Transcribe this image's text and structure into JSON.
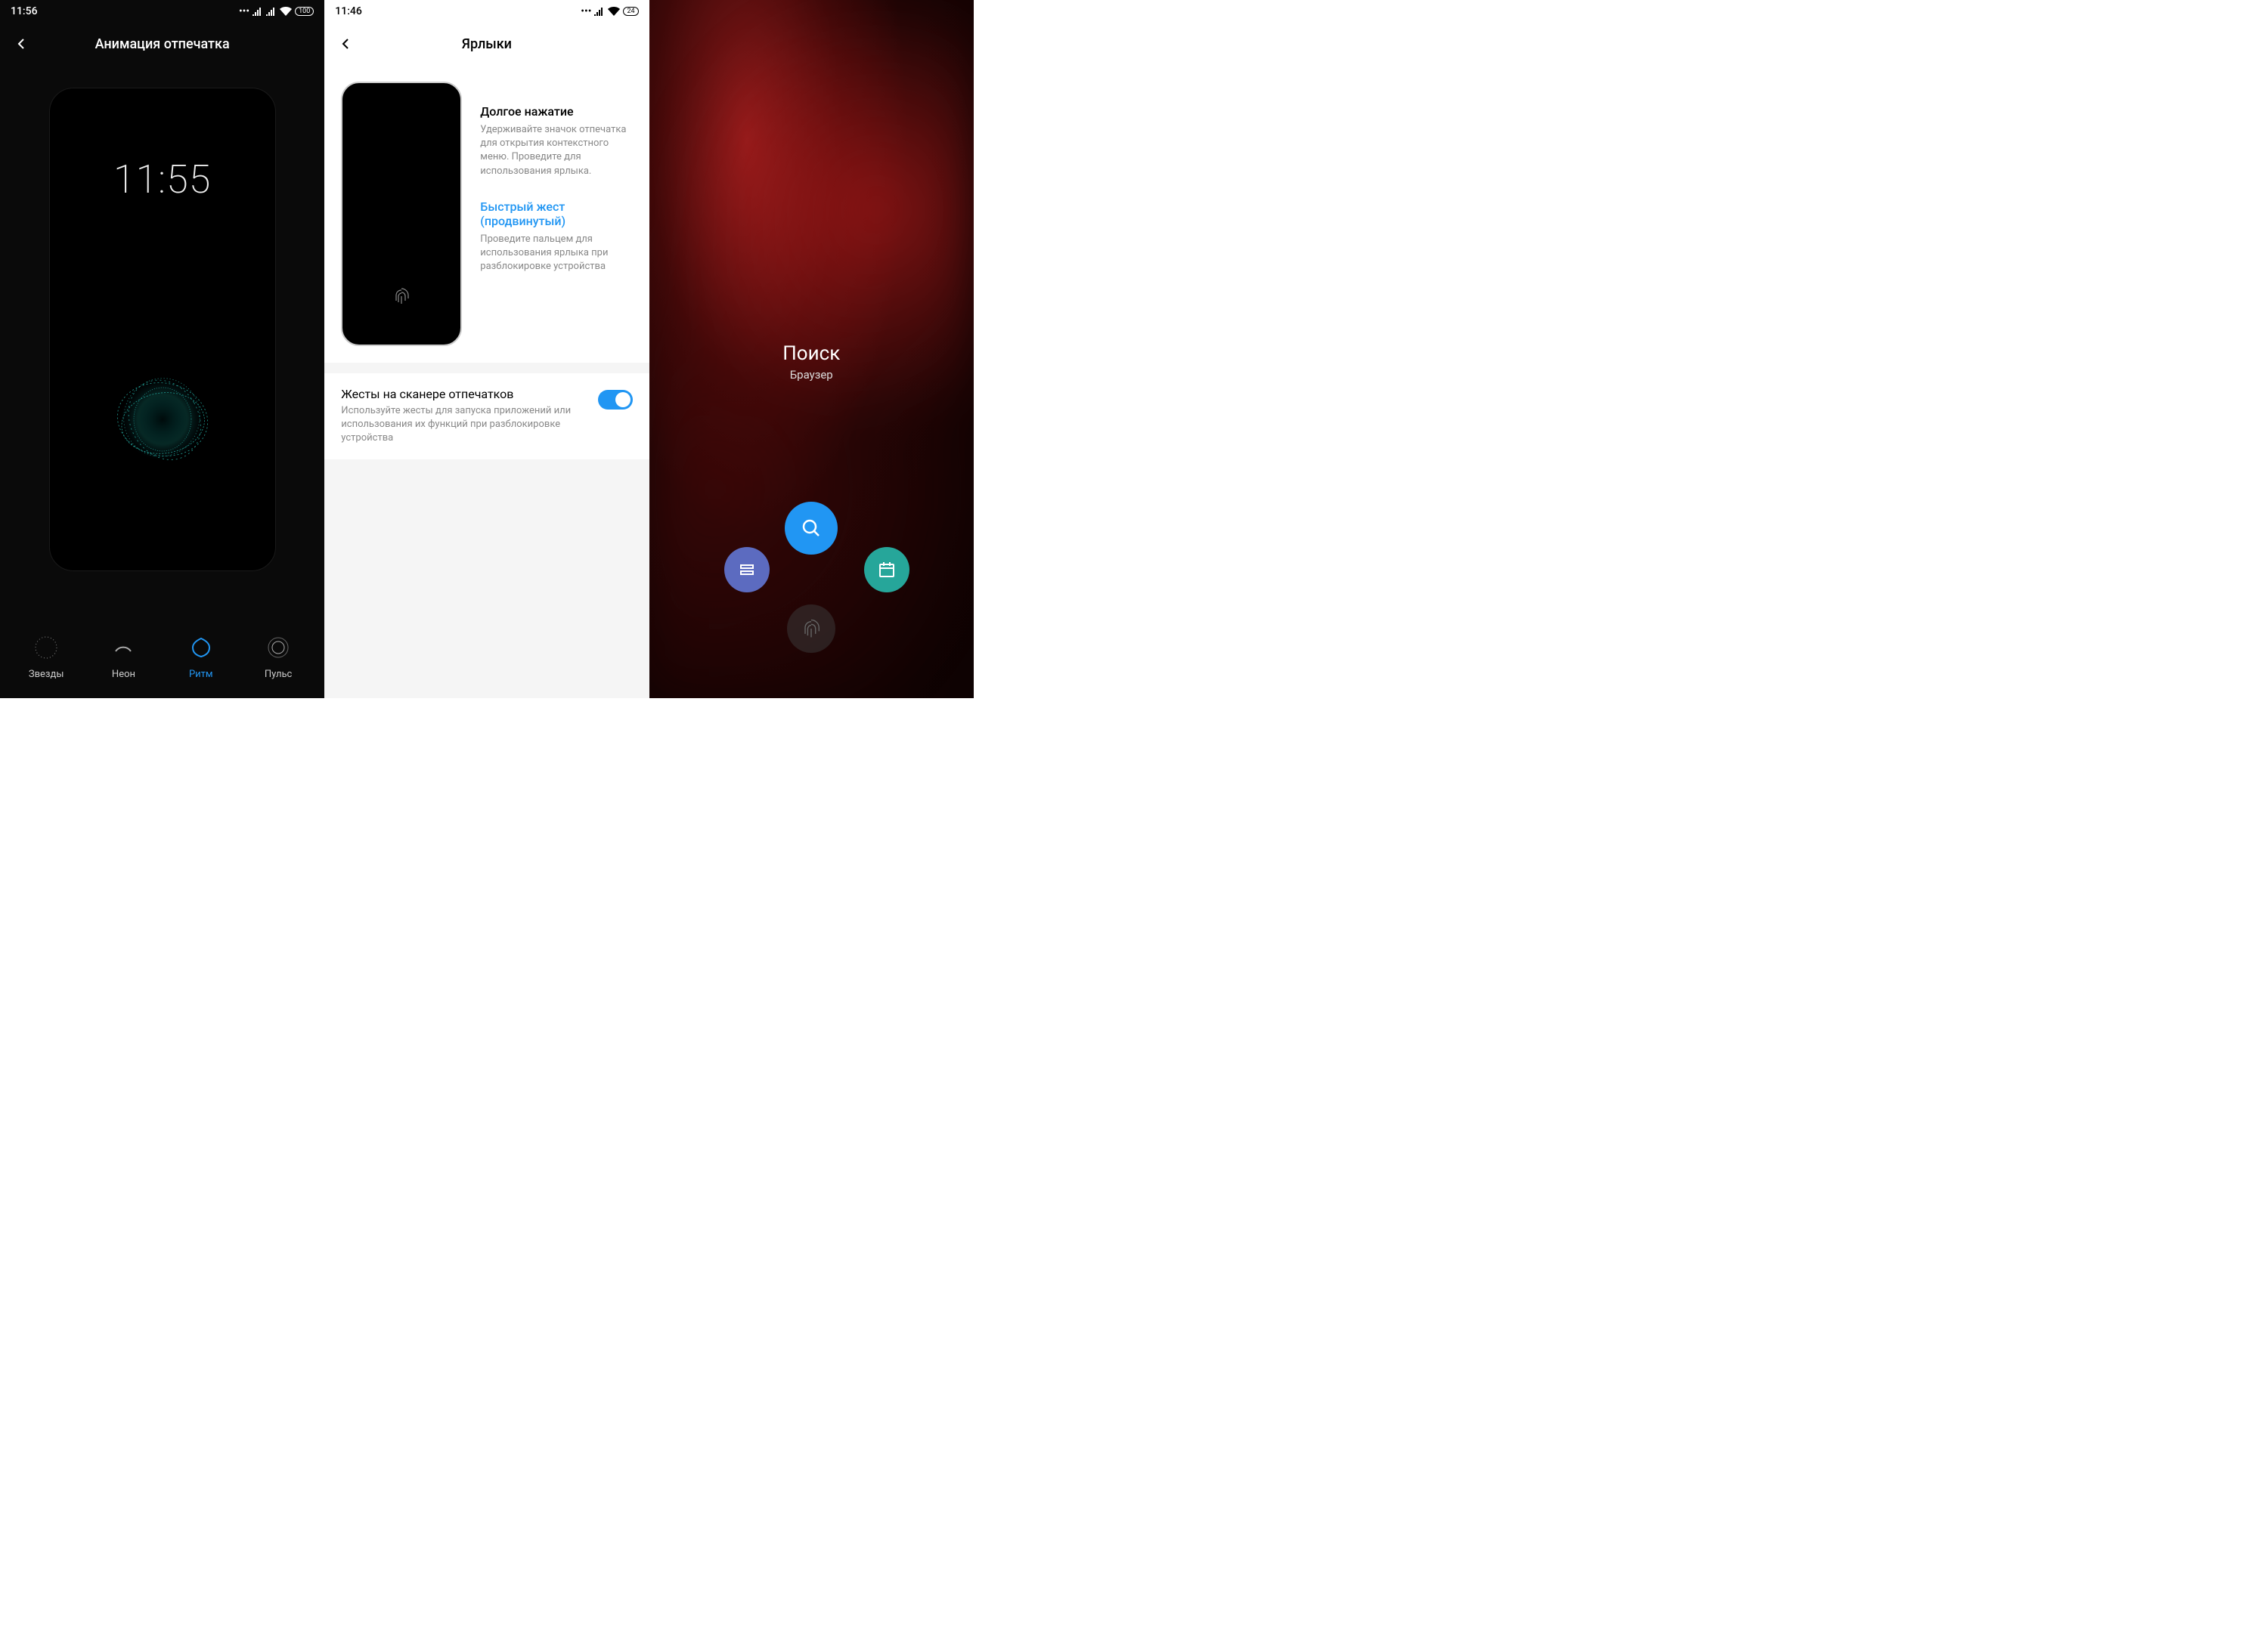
{
  "screen1": {
    "status_time": "11:56",
    "battery": "100",
    "title": "Анимация отпечатка",
    "preview_time": "11:55",
    "options": [
      {
        "label": "Звезды",
        "active": false
      },
      {
        "label": "Неон",
        "active": false
      },
      {
        "label": "Ритм",
        "active": true
      },
      {
        "label": "Пульс",
        "active": false
      }
    ]
  },
  "screen2": {
    "status_time": "11:46",
    "battery": "24",
    "title": "Ярлыки",
    "long_press": {
      "title": "Долгое нажатие",
      "desc": "Удерживайте значок отпечатка для открытия контекстного меню. Проведите для использования ярлыка."
    },
    "quick_gesture": {
      "title": "Быстрый жест (продвинутый)",
      "desc": "Проведите пальцем для использования ярлыка при разблокировке устройства"
    },
    "toggle": {
      "title": "Жесты на сканере отпечатков",
      "desc": "Используйте жесты для запуска приложений или использования их функций при разблокировке устройства",
      "on": true
    }
  },
  "screen3": {
    "search_title": "Поиск",
    "search_sub": "Браузер",
    "buttons": {
      "top": "search",
      "left": "menu",
      "right": "calendar",
      "center": "fingerprint"
    }
  }
}
